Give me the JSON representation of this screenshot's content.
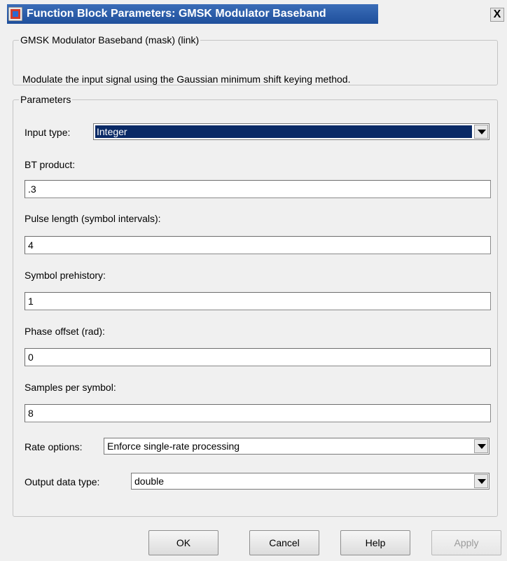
{
  "window": {
    "title": "Function Block Parameters: GMSK Modulator Baseband",
    "close_label": "X",
    "icon": "simulink-block-icon"
  },
  "description": {
    "group_title": "GMSK Modulator Baseband (mask) (link)",
    "text": "Modulate the input signal using the Gaussian minimum shift keying method."
  },
  "parameters": {
    "group_title": "Parameters",
    "input_type": {
      "label": "Input type:",
      "value": "Integer"
    },
    "bt_product": {
      "label": "BT product:",
      "value": ".3"
    },
    "pulse_length": {
      "label": "Pulse length (symbol intervals):",
      "value": "4"
    },
    "symbol_prehistory": {
      "label": "Symbol prehistory:",
      "value": "1"
    },
    "phase_offset": {
      "label": "Phase offset (rad):",
      "value": "0"
    },
    "samples_per_symbol": {
      "label": "Samples per symbol:",
      "value": "8"
    },
    "rate_options": {
      "label": "Rate options:",
      "value": "Enforce single-rate processing"
    },
    "output_data_type": {
      "label": "Output data type:",
      "value": "double"
    }
  },
  "buttons": {
    "ok": "OK",
    "cancel": "Cancel",
    "help": "Help",
    "apply": "Apply"
  },
  "colors": {
    "title_bar": "#2a5aa6",
    "selection": "#0a2a66",
    "background": "#f0f0f0"
  }
}
